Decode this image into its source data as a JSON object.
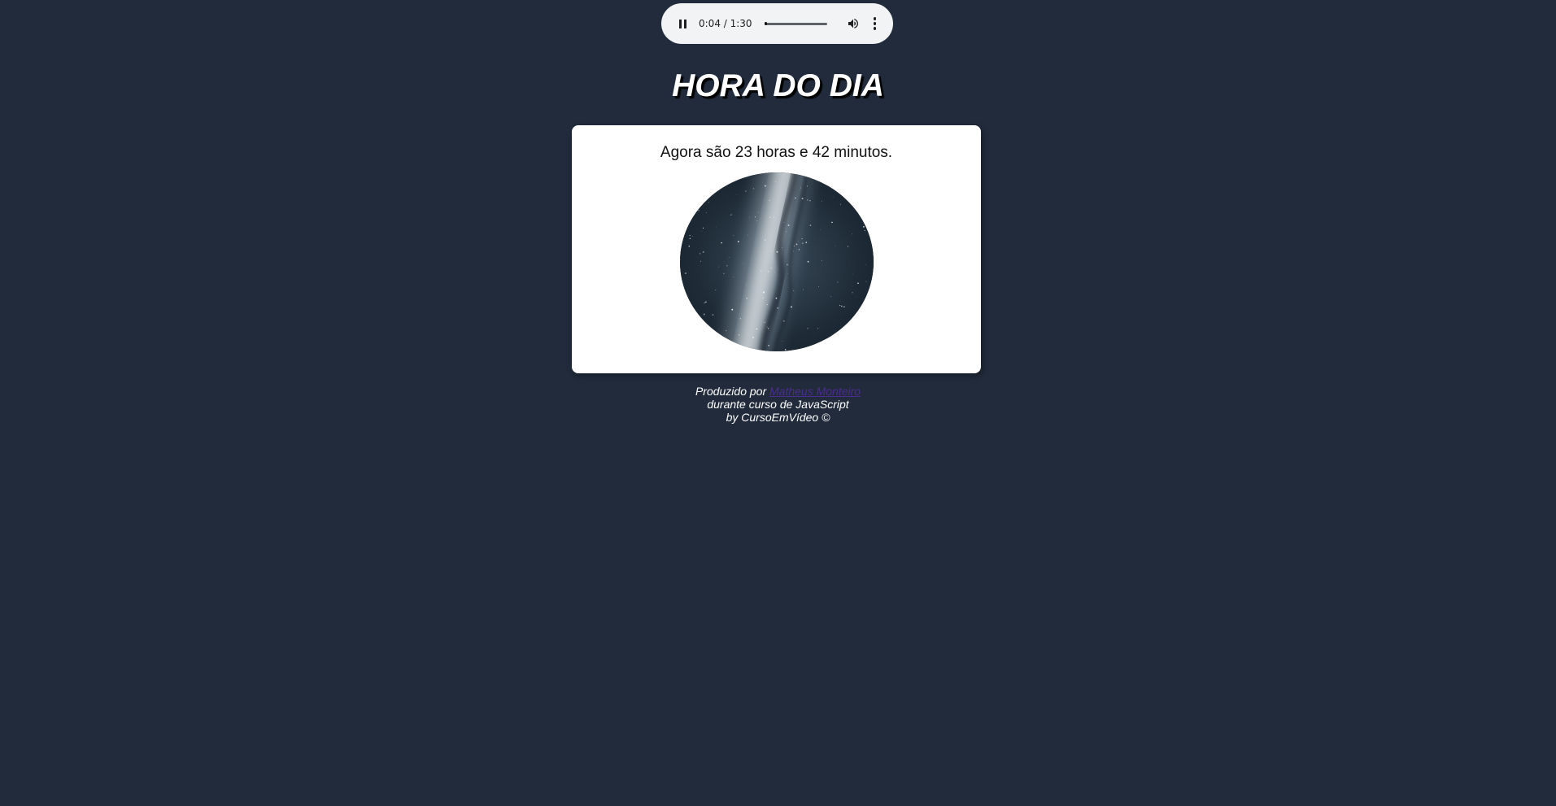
{
  "audio": {
    "time_label": "0:04 / 1:30",
    "progress": 0.044,
    "icons": {
      "pause": "pause-icon",
      "volume": "volume-icon",
      "menu": "more-vert-icon"
    }
  },
  "header": {
    "title": "HORA DO DIA"
  },
  "main": {
    "message": "Agora são 23 horas e 42 minutos.",
    "image_alt": "night sky image"
  },
  "footer": {
    "produced_by_prefix": "Produzido por ",
    "author_link": "Matheus Monteiro",
    "line2": "durante curso de JavaScript",
    "line3": "by CursoEmVídeo ©"
  },
  "colors": {
    "page_background": "#212b3b",
    "card_background": "#ffffff",
    "link": "#4b2d8c"
  }
}
